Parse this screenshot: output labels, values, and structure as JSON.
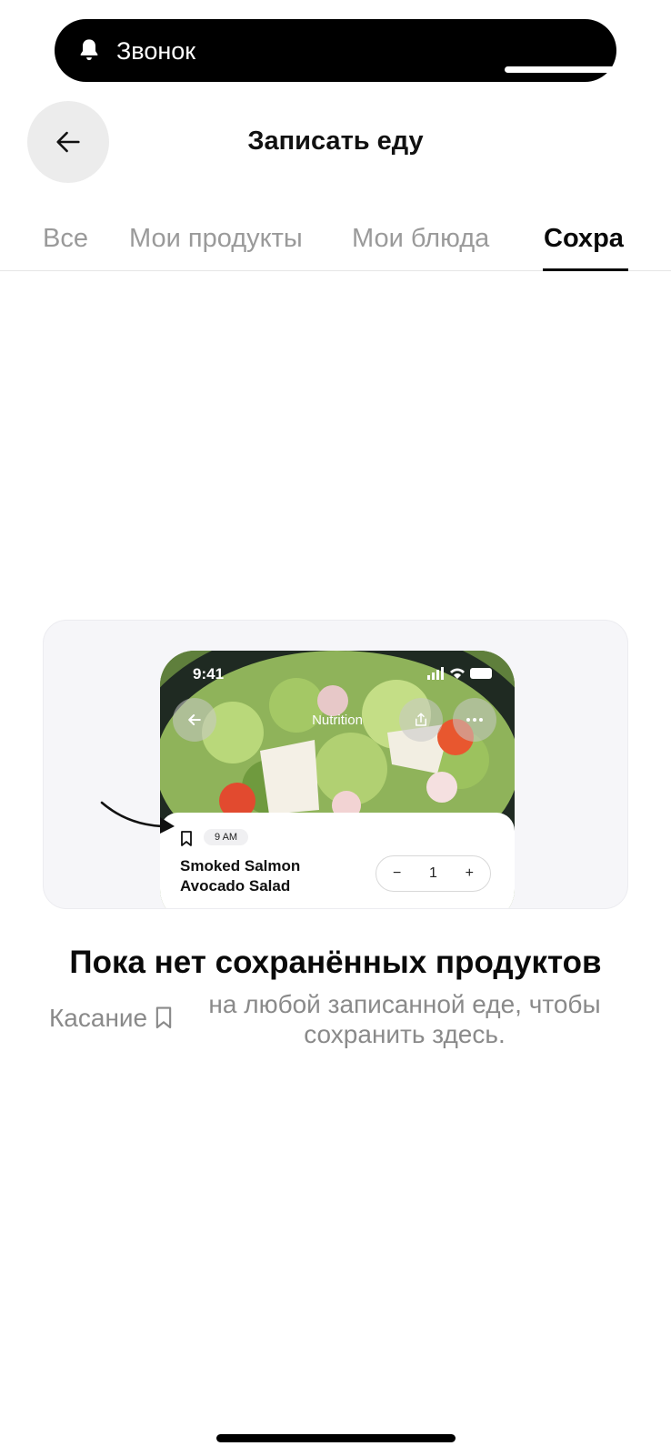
{
  "call_banner": {
    "label": "Звонок",
    "icon": "bell-icon"
  },
  "header": {
    "title": "Записать еду",
    "back_icon": "arrow-left-icon"
  },
  "tabs": [
    {
      "label": "Все",
      "active": false
    },
    {
      "label": "Мои продукты",
      "active": false
    },
    {
      "label": "Мои блюда",
      "active": false
    },
    {
      "label": "Сохра",
      "active": true
    }
  ],
  "illustration": {
    "time": "9:41",
    "screen_title": "Nutrition",
    "meal_time": "9 AM",
    "dish_line1": "Smoked Salmon",
    "dish_line2": "Avocado Salad",
    "quantity": "1",
    "minus": "−",
    "plus": "+"
  },
  "empty_state": {
    "title": "Пока нет сохранённых продуктов",
    "hint_prefix": "Касание",
    "hint_icon": "bookmark-icon",
    "hint_text": "на любой записанной еде, чтобы сохранить здесь."
  },
  "colors": {
    "accent": "#000000",
    "inactive_tab": "#9a9a9a",
    "hint": "#8a8a8a"
  }
}
